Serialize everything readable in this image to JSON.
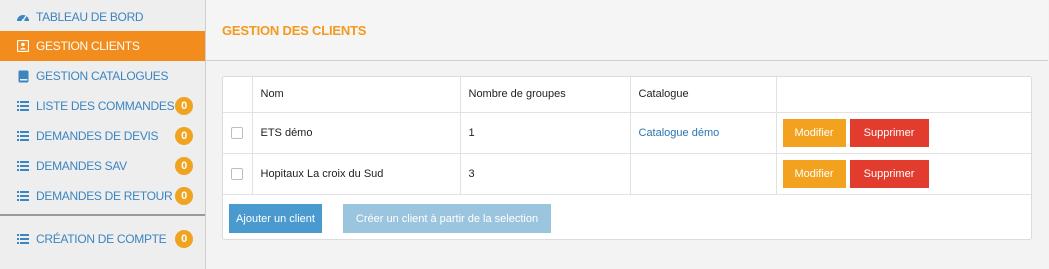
{
  "sidebar": {
    "items": [
      {
        "label": "TABLEAU DE BORD",
        "icon": "dashboard-icon"
      },
      {
        "label": "GESTION CLIENTS",
        "icon": "contact-card-icon",
        "active": true
      },
      {
        "label": "GESTION CATALOGUES",
        "icon": "book-icon"
      },
      {
        "label": "LISTE DES COMMANDES",
        "icon": "list-icon",
        "badge": "0"
      },
      {
        "label": "DEMANDES DE DEVIS",
        "icon": "list-icon",
        "badge": "0"
      },
      {
        "label": "DEMANDES SAV",
        "icon": "list-icon",
        "badge": "0"
      },
      {
        "label": "DEMANDES DE RETOUR",
        "icon": "list-icon",
        "badge": "0"
      },
      {
        "label": "CRÉATION DE COMPTE",
        "icon": "list-icon",
        "badge": "0"
      }
    ]
  },
  "main": {
    "title": "GESTION DES CLIENTS",
    "table": {
      "headers": [
        "",
        "Nom",
        "Nombre de groupes",
        "Catalogue",
        ""
      ],
      "rows": [
        {
          "nom": "ETS démo",
          "groupes": "1",
          "catalogue": "Catalogue démo"
        },
        {
          "nom": "Hopitaux La croix du Sud",
          "groupes": "3",
          "catalogue": ""
        }
      ],
      "modifier_label": "Modifier",
      "supprimer_label": "Supprimer"
    },
    "buttons": {
      "add_label": "Ajouter un client",
      "copy_label": "Créer un client à partir de la selection"
    }
  },
  "colors": {
    "accent": "#f28c1c",
    "title": "#f29a1e",
    "link": "#3c85c0",
    "badge": "#f0a31f",
    "modifier": "#f2a21e",
    "supprimer": "#e23c2f",
    "primary": "#4a9ad0",
    "primary_disabled": "#9bc5de"
  }
}
